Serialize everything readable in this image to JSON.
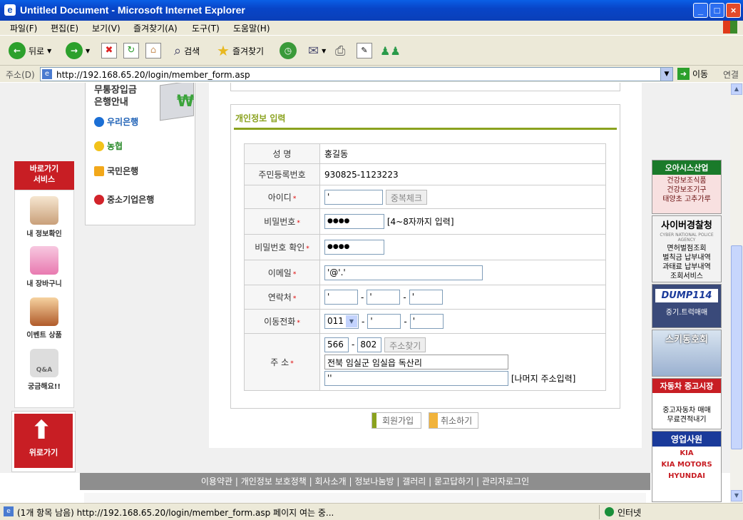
{
  "window": {
    "title": "Untitled Document - Microsoft Internet Explorer"
  },
  "menu": [
    "파일(F)",
    "편집(E)",
    "보기(V)",
    "즐겨찾기(A)",
    "도구(T)",
    "도움말(H)"
  ],
  "toolbar": {
    "back": "뒤로",
    "search": "검색",
    "favorites": "즐겨찾기"
  },
  "address": {
    "label": "주소(D)",
    "url": "http://192.168.65.20/login/member_form.asp",
    "go": "이동",
    "links": "연결"
  },
  "status": {
    "message": "(1개 항목 남음) http://192.168.65.20/login/member_form.asp 페이지 여는 중...",
    "zone": "인터넷"
  },
  "leftnav": {
    "header": "바로가기\n서비스",
    "items": [
      "내 정보확인",
      "내 장바구니",
      "이벤트 상품",
      "궁금해요!!"
    ],
    "top_label": "위로가기"
  },
  "banks": {
    "title": "무통장입금\n은행안내",
    "list": [
      "우리은행",
      "농협",
      "국민은행",
      "중소기업은행"
    ],
    "won": "₩"
  },
  "form": {
    "section_title": "개인정보 입력",
    "rows": {
      "name": {
        "label": "성 명",
        "value": "홍길동"
      },
      "ssn": {
        "label": "주민등록번호",
        "value": "930825-1123223"
      },
      "userid": {
        "label": "아이디",
        "value": "'",
        "button": "중복체크"
      },
      "password": {
        "label": "비밀번호",
        "value": "●●●●",
        "hint": "[4~8자까지 입력]"
      },
      "password_confirm": {
        "label": "비밀번호 확인",
        "value": "●●●●"
      },
      "email": {
        "label": "이메일",
        "value": "'@'.'"
      },
      "phone": {
        "label": "연락처",
        "values": [
          "'",
          "'",
          "'"
        ]
      },
      "mobile": {
        "label": "이동전화",
        "carrier": "011",
        "values": [
          "'",
          "'"
        ]
      },
      "address": {
        "label": "주 소",
        "zip1": "566",
        "zip2": "802",
        "zip_button": "주소찾기",
        "addr1": "전북 임실군 임실읍 독산리",
        "addr2": "''",
        "addr2_hint": "[나머지 주소입력]"
      }
    },
    "required_mark": "*",
    "submit": "회원가입",
    "cancel": "취소하기"
  },
  "footer": {
    "links": "이용약관 | 개인정보 보호정책 | 회사소개 | 정보나눔방 | 갤러리 | 묻고답하기 | 관리자로그인"
  },
  "ads": [
    {
      "head": "오아시스산업",
      "body": "건강보조식품\n건강보조기구\n태양초 고추가루"
    },
    {
      "head": "사이버경찰청",
      "sub": "CYBER NATIONAL POLICE AGENCY",
      "body": "면허벌점조회\n벌칙금 납부내역\n과태료 납부내역\n조회서비스"
    },
    {
      "head": "DUMP114",
      "body": "중기.트럭매매"
    },
    {
      "head": "스키동호회",
      "body": ""
    },
    {
      "head": "자동차 중고시장",
      "body": "중고자동차 매매\n무료견적내기"
    },
    {
      "head": "영업사원",
      "body": "KIA\nKIA MOTORS\nHYUNDAI"
    }
  ]
}
